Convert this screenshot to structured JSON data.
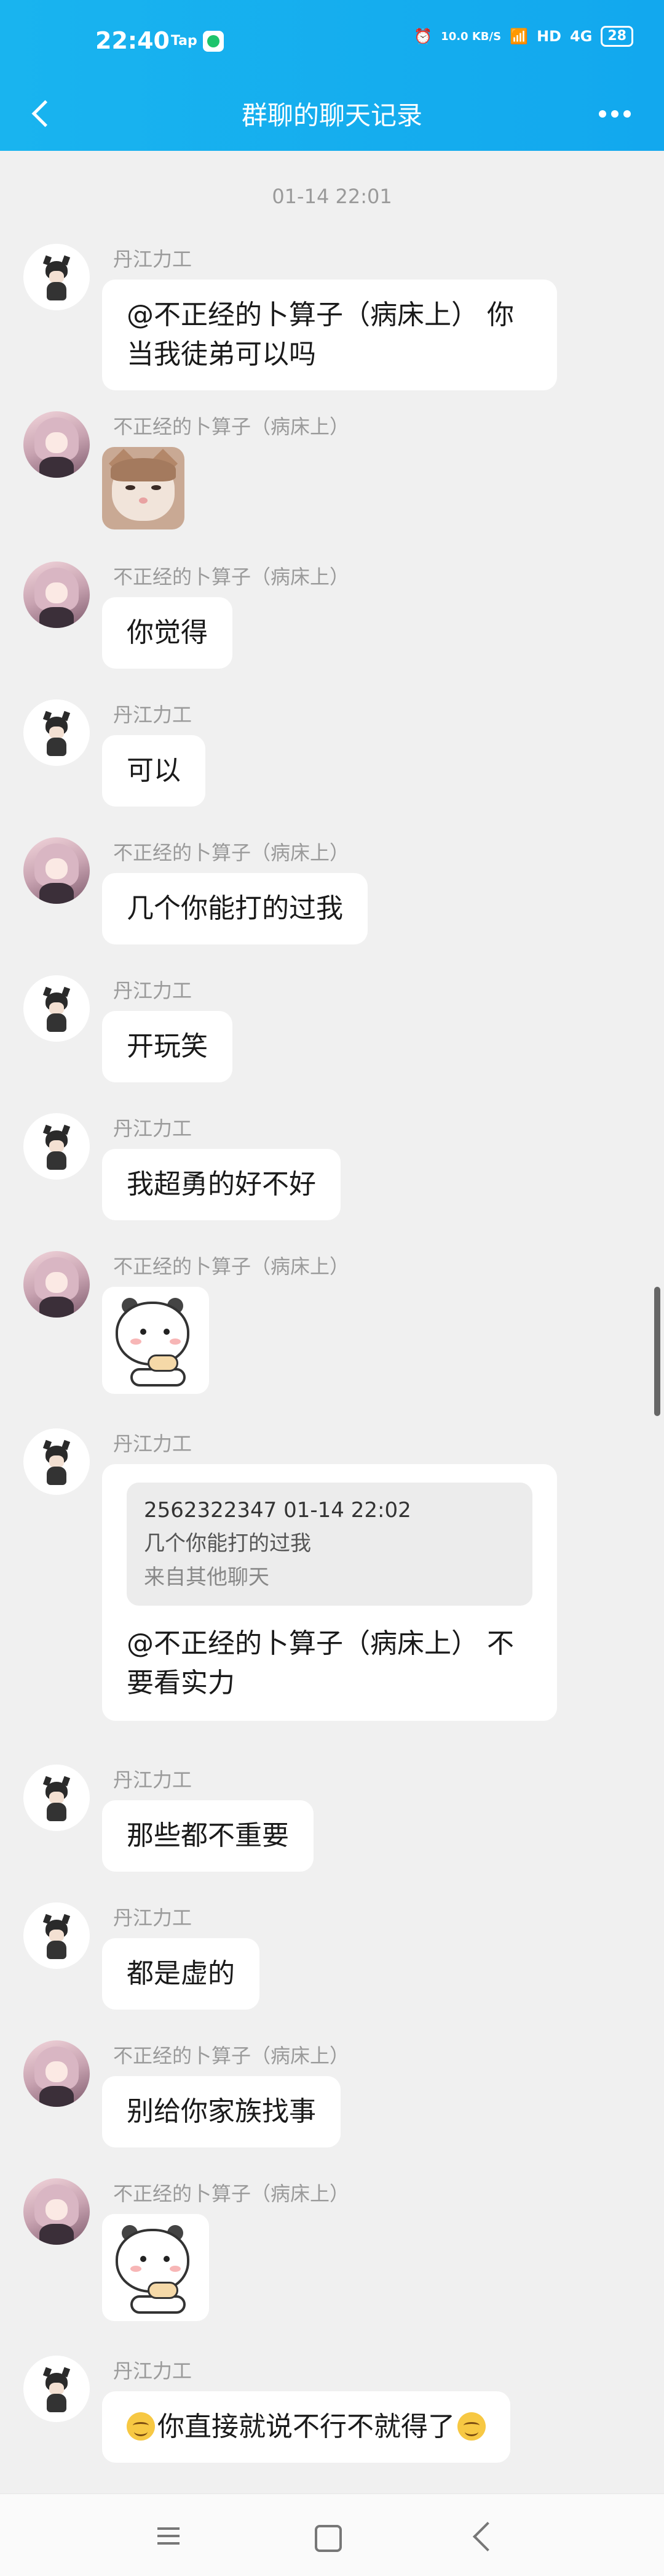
{
  "status_bar": {
    "time": "22:40",
    "tap_label": "Tap",
    "net_speed": "10.0 KB/S",
    "hd_label": "HD",
    "signal_label": "4G",
    "battery": "28"
  },
  "header": {
    "title": "群聊的聊天记录"
  },
  "date_separator": "01-14 22:01",
  "messages": [
    {
      "sender": "丹江力工",
      "text": "@不正经的卜算子（病床上） 你当我徒弟可以吗"
    },
    {
      "sender": "不正经的卜算子（病床上）",
      "sticker": "cat-sticker"
    },
    {
      "sender": "不正经的卜算子（病床上）",
      "text": "你觉得"
    },
    {
      "sender": "丹江力工",
      "text": "可以"
    },
    {
      "sender": "不正经的卜算子（病床上）",
      "text": "几个你能打的过我"
    },
    {
      "sender": "丹江力工",
      "text": "开玩笑"
    },
    {
      "sender": "丹江力工",
      "text": "我超勇的好不好"
    },
    {
      "sender": "不正经的卜算子（病床上）",
      "sticker": "mochi-cat-sticker"
    },
    {
      "sender": "丹江力工",
      "quote": {
        "meta": "2562322347 01-14 22:02",
        "text": "几个你能打的过我",
        "source": "来自其他聊天"
      },
      "text": "@不正经的卜算子（病床上） 不要看实力"
    },
    {
      "sender": "丹江力工",
      "text": "那些都不重要"
    },
    {
      "sender": "丹江力工",
      "text": "都是虚的"
    },
    {
      "sender": "不正经的卜算子（病床上）",
      "text": "别给你家族找事"
    },
    {
      "sender": "不正经的卜算子（病床上）",
      "sticker": "mochi-cat-sticker"
    },
    {
      "sender": "丹江力工",
      "text": "你直接就说不行不就得了"
    }
  ]
}
